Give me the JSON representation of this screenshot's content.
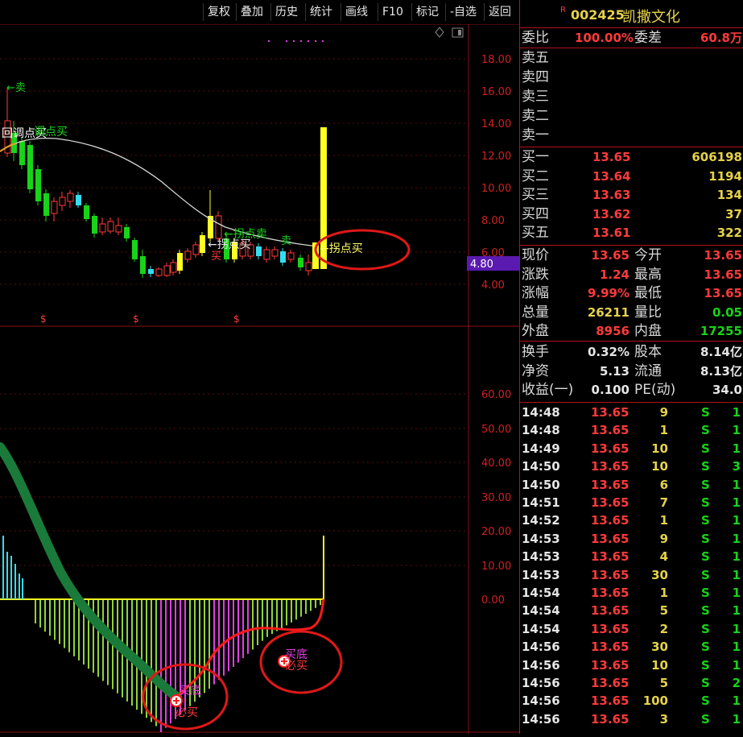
{
  "toolbar": {
    "items": [
      "复权",
      "叠加",
      "历史",
      "统计",
      "画线",
      "F10",
      "标记",
      "-自选",
      "返回"
    ]
  },
  "price_chart": {
    "y_ticks": [
      "18.00",
      "16.00",
      "14.00",
      "12.00",
      "10.00",
      "8.00",
      "6.00",
      "4.00"
    ],
    "current_price_tag": "4.80",
    "annotations": {
      "sell_top": "←卖",
      "pullback": "回调点买",
      "pullback_2": "调点买",
      "turn_sell": "←拐点卖",
      "turn_buy": "←拐点买",
      "sell_small": "卖",
      "buy_small": "买",
      "turn_buy_right": "←拐点买",
      "dollar_marks": [
        "$",
        "$",
        "$"
      ]
    }
  },
  "indicator_chart": {
    "y_ticks": [
      "60.00",
      "50.00",
      "40.00",
      "30.00",
      "20.00",
      "10.00",
      "0.00"
    ],
    "labels": {
      "left_bottom_1": "买底",
      "left_bottom_2": "必买",
      "right_bottom_1": "买底",
      "right_bottom_2": "必买"
    }
  },
  "quote": {
    "flag": "R",
    "code": "002425",
    "name": "凯撒文化",
    "weibi_label": "委比",
    "weibi_value": "100.00%",
    "weicha_label": "委差",
    "weicha_value": "60.8万",
    "sell_levels": [
      "卖五",
      "卖四",
      "卖三",
      "卖二",
      "卖一"
    ],
    "buy_levels": [
      {
        "label": "买一",
        "price": "13.65",
        "vol": "606198"
      },
      {
        "label": "买二",
        "price": "13.64",
        "vol": "1194"
      },
      {
        "label": "买三",
        "price": "13.63",
        "vol": "134"
      },
      {
        "label": "买四",
        "price": "13.62",
        "vol": "37"
      },
      {
        "label": "买五",
        "price": "13.61",
        "vol": "322"
      }
    ],
    "stats": [
      {
        "l1": "现价",
        "v1": "13.65",
        "c1": "red",
        "l2": "今开",
        "v2": "13.65",
        "c2": "red"
      },
      {
        "l1": "涨跌",
        "v1": "1.24",
        "c1": "red",
        "l2": "最高",
        "v2": "13.65",
        "c2": "red"
      },
      {
        "l1": "涨幅",
        "v1": "9.99%",
        "c1": "red",
        "l2": "最低",
        "v2": "13.65",
        "c2": "red"
      },
      {
        "l1": "总量",
        "v1": "26211",
        "c1": "yel",
        "l2": "量比",
        "v2": "0.05",
        "c2": "grn"
      },
      {
        "l1": "外盘",
        "v1": "8956",
        "c1": "red",
        "l2": "内盘",
        "v2": "17255",
        "c2": "grn"
      }
    ],
    "fundamentals": [
      {
        "l1": "换手",
        "v1": "0.32%",
        "l2": "股本",
        "v2": "8.14亿"
      },
      {
        "l1": "净资",
        "v1": "5.13",
        "l2": "流通",
        "v2": "8.13亿"
      },
      {
        "l1": "收益(一)",
        "v1": "0.100",
        "l2": "PE(动)",
        "v2": "34.0"
      }
    ],
    "ticks": [
      {
        "time": "14:48",
        "price": "13.65",
        "vol": "9",
        "side": "S",
        "n": "1"
      },
      {
        "time": "14:48",
        "price": "13.65",
        "vol": "1",
        "side": "S",
        "n": "1"
      },
      {
        "time": "14:49",
        "price": "13.65",
        "vol": "10",
        "side": "S",
        "n": "1"
      },
      {
        "time": "14:50",
        "price": "13.65",
        "vol": "10",
        "side": "S",
        "n": "3"
      },
      {
        "time": "14:50",
        "price": "13.65",
        "vol": "6",
        "side": "S",
        "n": "1"
      },
      {
        "time": "14:51",
        "price": "13.65",
        "vol": "7",
        "side": "S",
        "n": "1"
      },
      {
        "time": "14:52",
        "price": "13.65",
        "vol": "1",
        "side": "S",
        "n": "1"
      },
      {
        "time": "14:53",
        "price": "13.65",
        "vol": "9",
        "side": "S",
        "n": "1"
      },
      {
        "time": "14:53",
        "price": "13.65",
        "vol": "4",
        "side": "S",
        "n": "1"
      },
      {
        "time": "14:53",
        "price": "13.65",
        "vol": "30",
        "side": "S",
        "n": "1"
      },
      {
        "time": "14:54",
        "price": "13.65",
        "vol": "1",
        "side": "S",
        "n": "1"
      },
      {
        "time": "14:54",
        "price": "13.65",
        "vol": "5",
        "side": "S",
        "n": "1"
      },
      {
        "time": "14:54",
        "price": "13.65",
        "vol": "2",
        "side": "S",
        "n": "1"
      },
      {
        "time": "14:56",
        "price": "13.65",
        "vol": "30",
        "side": "S",
        "n": "1"
      },
      {
        "time": "14:56",
        "price": "13.65",
        "vol": "10",
        "side": "S",
        "n": "1"
      },
      {
        "time": "14:56",
        "price": "13.65",
        "vol": "5",
        "side": "S",
        "n": "2"
      },
      {
        "time": "14:56",
        "price": "13.65",
        "vol": "100",
        "side": "S",
        "n": "1"
      },
      {
        "time": "14:56",
        "price": "13.65",
        "vol": "3",
        "side": "S",
        "n": "1"
      }
    ]
  },
  "colors": {
    "up": "#ff3a3a",
    "down": "#18d418",
    "grid_red": "#8a0f15",
    "yellow": "#ffff22",
    "magenta": "#e040e0",
    "cyan": "#33ddee",
    "label_text": "#d9d9d9"
  }
}
